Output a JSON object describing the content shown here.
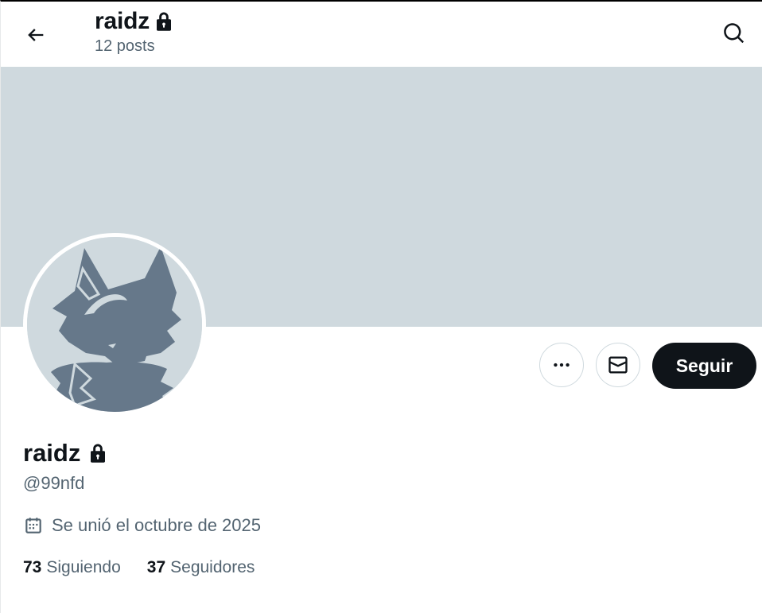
{
  "header": {
    "name": "raidz",
    "posts": "12 posts",
    "icons": {
      "back": "arrow-left-icon",
      "lock": "lock-icon",
      "search": "search-icon"
    }
  },
  "banner": {
    "color": "#cfd9de"
  },
  "avatar": {
    "description_icon": "fox-silhouette-avatar",
    "color": "#66788a"
  },
  "actions": {
    "more_icon": "more-dots-icon",
    "message_icon": "envelope-icon",
    "follow_label": "Seguir"
  },
  "profile": {
    "name": "raidz",
    "handle": "@99nfd",
    "joined": "Se unió el octubre de 2025",
    "joined_icon": "calendar-icon",
    "following_count": "73",
    "following_label": "Siguiendo",
    "followers_count": "37",
    "followers_label": "Seguidores"
  },
  "colors": {
    "text_primary": "#0f1419",
    "text_secondary": "#536471",
    "banner": "#cfd9de",
    "follow_button_bg": "#0f1419",
    "follow_button_text": "#ffffff"
  }
}
